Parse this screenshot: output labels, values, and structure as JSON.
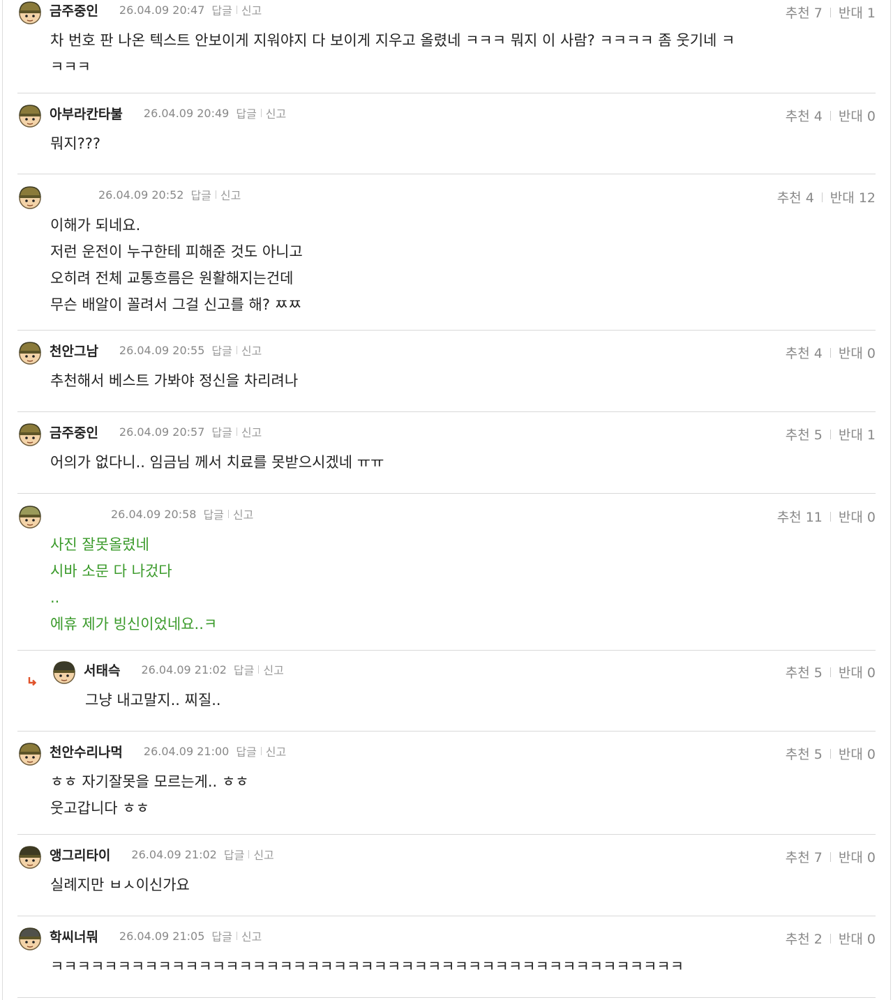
{
  "labels": {
    "reply": "답글",
    "report": "신고",
    "up": "추천",
    "down": "반대"
  },
  "comments": [
    {
      "nick": "금주중인",
      "date": "26.04.09 20:47",
      "up": "7",
      "down": "1",
      "lines": [
        "차 번호 판 나온 텍스트 안보이게 지워야지 다 보이게 지우고 올렸네 ㅋㅋㅋ 뭐지 이 사람? ㅋㅋㅋㅋ 좀 웃기네 ㅋ",
        "ㅋㅋㅋ"
      ]
    },
    {
      "nick": "아부라칸타불",
      "date": "26.04.09 20:49",
      "up": "4",
      "down": "0",
      "lines": [
        "뭐지???"
      ]
    },
    {
      "nick": "",
      "date": "26.04.09 20:52",
      "up": "4",
      "down": "12",
      "lines": [
        "이해가 되네요.",
        "저런 운전이 누구한테 피해준 것도 아니고",
        "오히려 전체 교통흐름은 원활해지는건데",
        "무슨 배알이 꼴려서 그걸 신고를 해? ㅉㅉ"
      ]
    },
    {
      "nick": "천안그남",
      "date": "26.04.09 20:55",
      "up": "4",
      "down": "0",
      "lines": [
        "추천해서 베스트 가봐야 정신을 차리려나"
      ]
    },
    {
      "nick": "금주중인",
      "date": "26.04.09 20:57",
      "up": "5",
      "down": "1",
      "lines": [
        "어의가 없다니.. 임금님 께서 치료를 못받으시겠네 ㅠㅠ"
      ]
    },
    {
      "nick": "",
      "date": "26.04.09 20:58",
      "up": "11",
      "down": "0",
      "lines": [
        "사진 잘못올렸네",
        "시바 소문 다 나겄다",
        "..",
        "에휴 제가 빙신이었네요..ㅋ"
      ]
    },
    {
      "nick": "서태슥",
      "date": "26.04.09 21:02",
      "up": "5",
      "down": "0",
      "lines": [
        "그냥 내고말지.. 찌질.."
      ]
    },
    {
      "nick": "천안수리나먹",
      "date": "26.04.09 21:00",
      "up": "5",
      "down": "0",
      "lines": [
        "ㅎㅎ 자기잘못을 모르는게.. ㅎㅎ",
        "웃고갑니다 ㅎㅎ"
      ]
    },
    {
      "nick": "앵그리타이",
      "date": "26.04.09 21:02",
      "up": "7",
      "down": "0",
      "lines": [
        "실례지만 ㅂㅅ이신가요"
      ]
    },
    {
      "nick": "학씨너뭐",
      "date": "26.04.09 21:05",
      "up": "2",
      "down": "0",
      "lines": [
        "ㅋㅋㅋㅋㅋㅋㅋㅋㅋㅋㅋㅋㅋㅋㅋㅋㅋㅋㅋㅋㅋㅋㅋㅋㅋㅋㅋㅋㅋㅋㅋㅋㅋㅋㅋㅋㅋㅋㅋㅋㅋㅋㅋㅋㅋㅋㅋ"
      ]
    }
  ]
}
